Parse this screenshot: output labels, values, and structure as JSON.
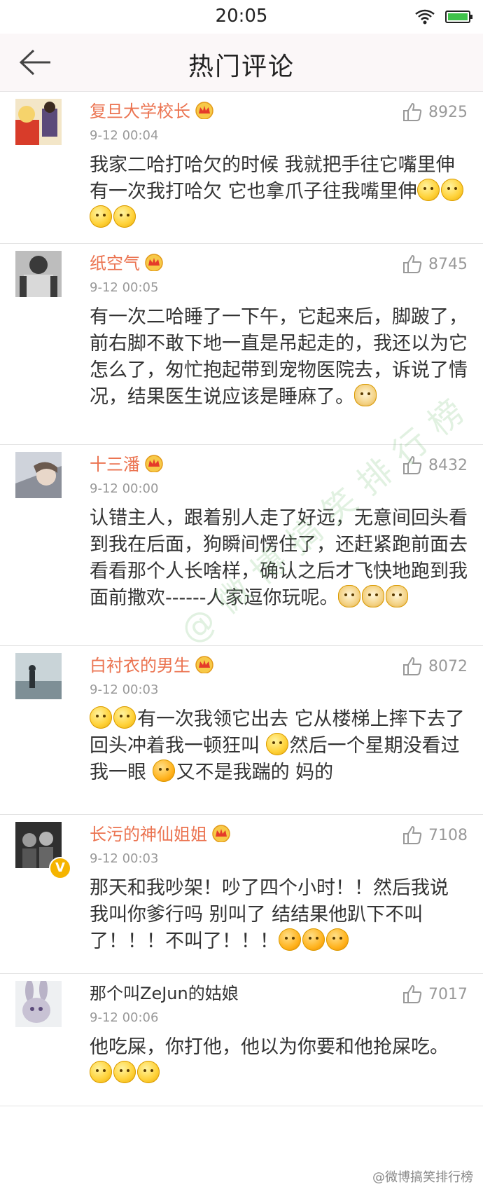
{
  "status_bar": {
    "time": "20:05",
    "wifi_icon": "wifi-icon",
    "battery_icon": "battery-icon"
  },
  "nav": {
    "title": "热门评论",
    "back_icon": "back-arrow-icon"
  },
  "colors": {
    "username": "#eb7350",
    "background": "#ffffff",
    "muted": "#999999"
  },
  "comments": [
    {
      "username": "复旦大学校长",
      "crown": true,
      "verified": false,
      "time": "9-12 00:04",
      "likes": "8925",
      "text": "我家二哈打哈欠的时候  我就把手往它嘴里伸  有一次我打哈欠  它也拿爪子往我嘴里伸",
      "emojis": [
        "thinking",
        "thinking",
        "thinking",
        "thinking"
      ]
    },
    {
      "username": "纸空气",
      "crown": true,
      "verified": false,
      "time": "9-12 00:05",
      "likes": "8745",
      "text": "有一次二哈睡了一下午，它起来后，脚跛了，前右脚不敢下地一直是吊起走的，我还以为它怎么了，匆忙抱起带到宠物医院去，诉说了情况，结果医生说应该是睡麻了。",
      "emojis": [
        "doge"
      ]
    },
    {
      "username": "十三潘",
      "crown": true,
      "verified": false,
      "time": "9-12 00:00",
      "likes": "8432",
      "text": "认错主人，跟着别人走了好远，无意间回头看到我在后面，狗瞬间愣住了，还赶紧跑前面去看看那个人长啥样，确认之后才飞快地跑到我面前撒欢------人家逗你玩呢。",
      "emojis": [
        "doge",
        "doge",
        "doge"
      ]
    },
    {
      "username": "白衬衣的男生",
      "crown": true,
      "verified": false,
      "time": "9-12 00:03",
      "likes": "8072",
      "text_parts": [
        "有一次我领它出去  它从楼梯上摔下去了  回头冲着我一顿狂叫  ",
        "然后一个星期没看过我一眼 ",
        "又不是我踹的  妈的"
      ]
    },
    {
      "username": "长污的神仙姐姐",
      "crown": true,
      "verified": true,
      "time": "9-12 00:03",
      "likes": "7108",
      "text": "那天和我吵架！吵了四个小时！！然后我说  我叫你爹行吗  别叫了   结结果他趴下不叫了！！！不叫了！！！",
      "emojis": [
        "angry",
        "angry",
        "angry"
      ]
    },
    {
      "username": "那个叫ZeJun的姑娘",
      "crown": false,
      "verified": false,
      "time": "9-12 00:06",
      "likes": "7017",
      "text": "他吃屎，你打他，他以为你要和他抢屎吃。",
      "emojis": [
        "thinking",
        "thinking",
        "thinking"
      ]
    }
  ],
  "watermark_bottom": "@微博搞笑排行榜",
  "watermark_center": "@微博搞笑排行榜"
}
